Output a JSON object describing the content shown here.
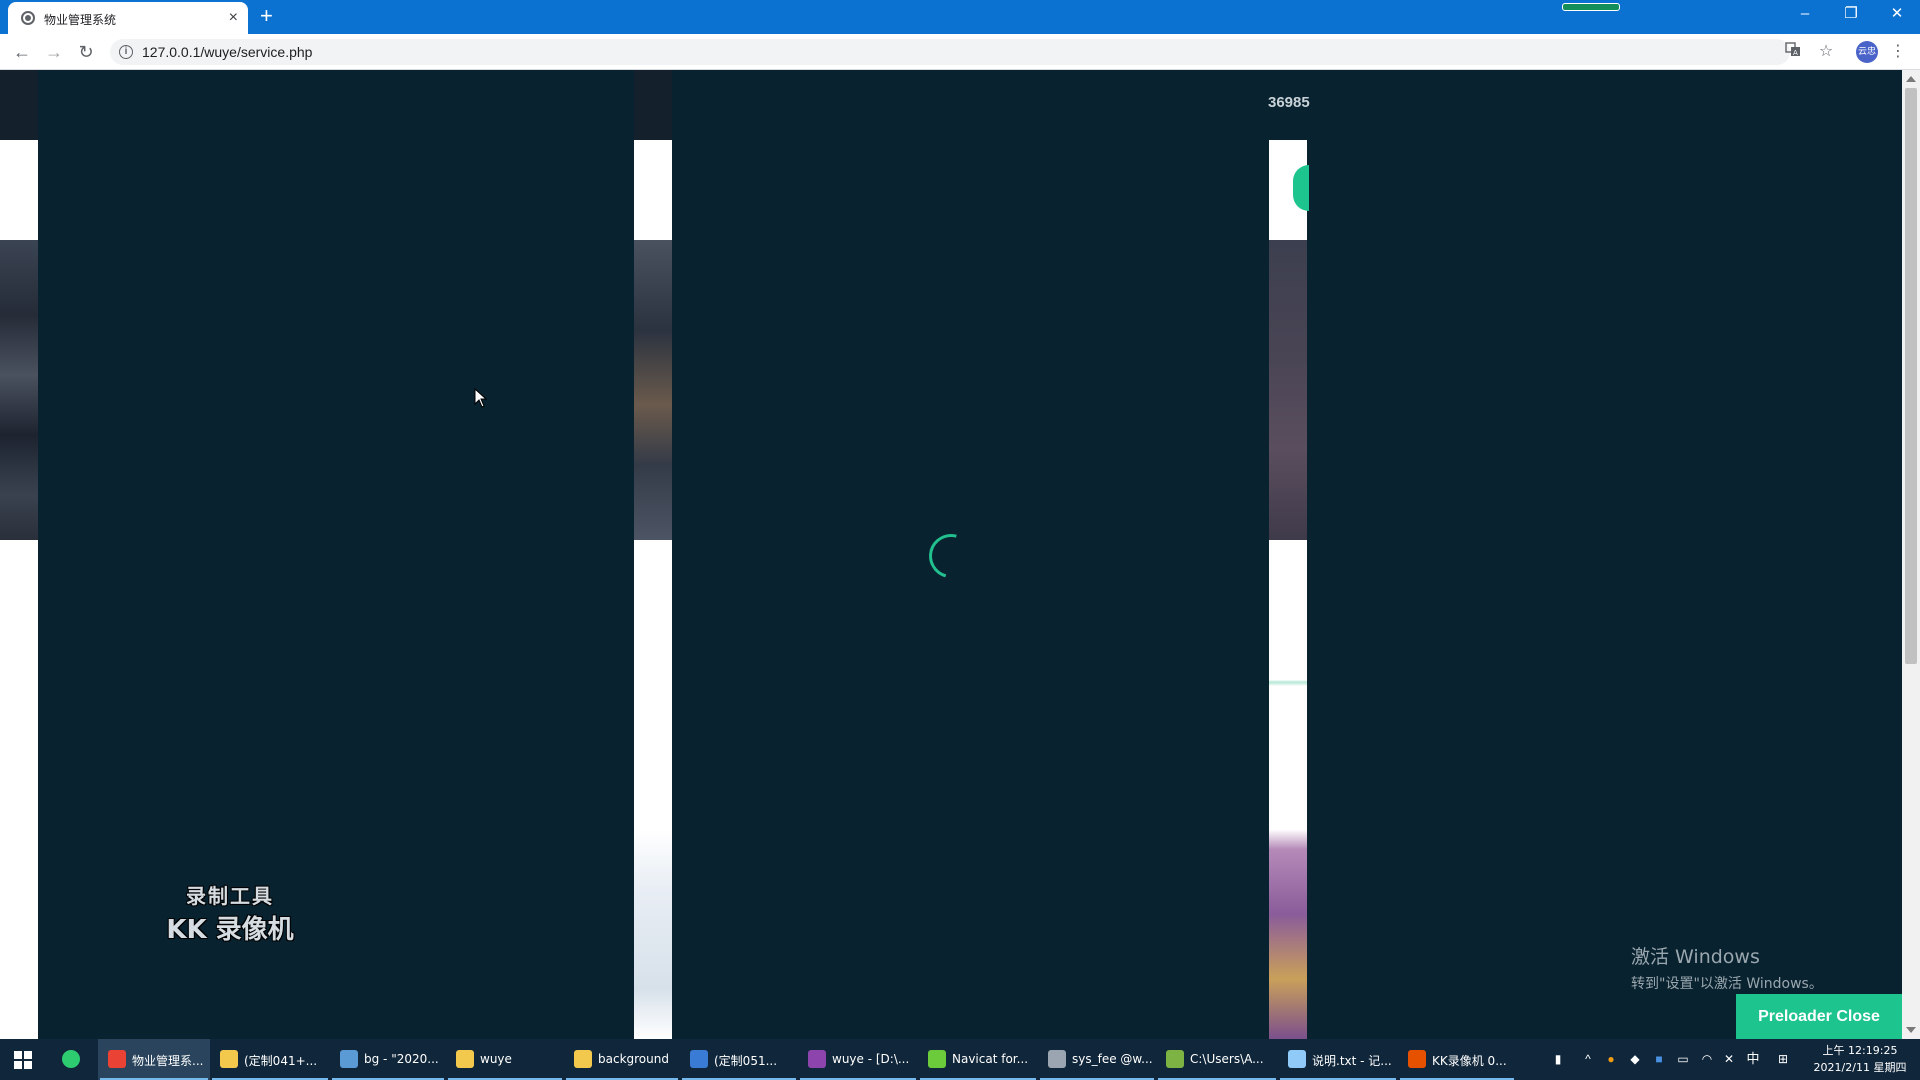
{
  "browser": {
    "tab_title": "物业管理系统",
    "tab_close": "×",
    "new_tab": "+",
    "url": "127.0.0.1/wuye/service.php",
    "profile_label": "云忠",
    "window_controls": {
      "minimize": "–",
      "restore": "❐",
      "close": "✕"
    },
    "icons": [
      "back-icon",
      "forward-icon",
      "reload-icon",
      "info-icon",
      "translate-icon",
      "star-icon",
      "menu-icon"
    ]
  },
  "page": {
    "phone_partial": "36985",
    "preloader_close": "Preloader Close",
    "spinner_color": "#22c08f",
    "background_color": "#08222f"
  },
  "overlays": {
    "recorder_line1": "录制工具",
    "recorder_line2": "KK 录像机",
    "activate_title": "激活 Windows",
    "activate_sub": "转到\"设置\"以激活 Windows。"
  },
  "taskbar": {
    "items": [
      {
        "label": "物业管理系...",
        "icon": "chrome-icon",
        "color": "#ea4335",
        "active": true
      },
      {
        "label": "(定制041+...",
        "icon": "folder-icon",
        "color": "#f2c94c"
      },
      {
        "label": "bg - \"2020...",
        "icon": "app-icon",
        "color": "#5b9bd5"
      },
      {
        "label": "wuye",
        "icon": "folder-icon",
        "color": "#f2c94c"
      },
      {
        "label": "background",
        "icon": "folder-icon",
        "color": "#f2c94c"
      },
      {
        "label": "(定制051...",
        "icon": "vscode-icon",
        "color": "#3a7bd5"
      },
      {
        "label": "wuye - [D:\\...",
        "icon": "phpstorm-icon",
        "color": "#8e44ad"
      },
      {
        "label": "Navicat for...",
        "icon": "navicat-icon",
        "color": "#6bcb3a"
      },
      {
        "label": "sys_fee @w...",
        "icon": "db-icon",
        "color": "#9aa5b1"
      },
      {
        "label": "C:\\Users\\A...",
        "icon": "editor-icon",
        "color": "#7cb342"
      },
      {
        "label": "说明.txt - 记...",
        "icon": "notepad-icon",
        "color": "#90caf9"
      },
      {
        "label": "KK录像机 0...",
        "icon": "kk-recorder-icon",
        "color": "#e65100"
      }
    ],
    "ime": "中",
    "clock_time": "上午 12:19:25",
    "clock_date": "2021/2/11 星期四"
  }
}
